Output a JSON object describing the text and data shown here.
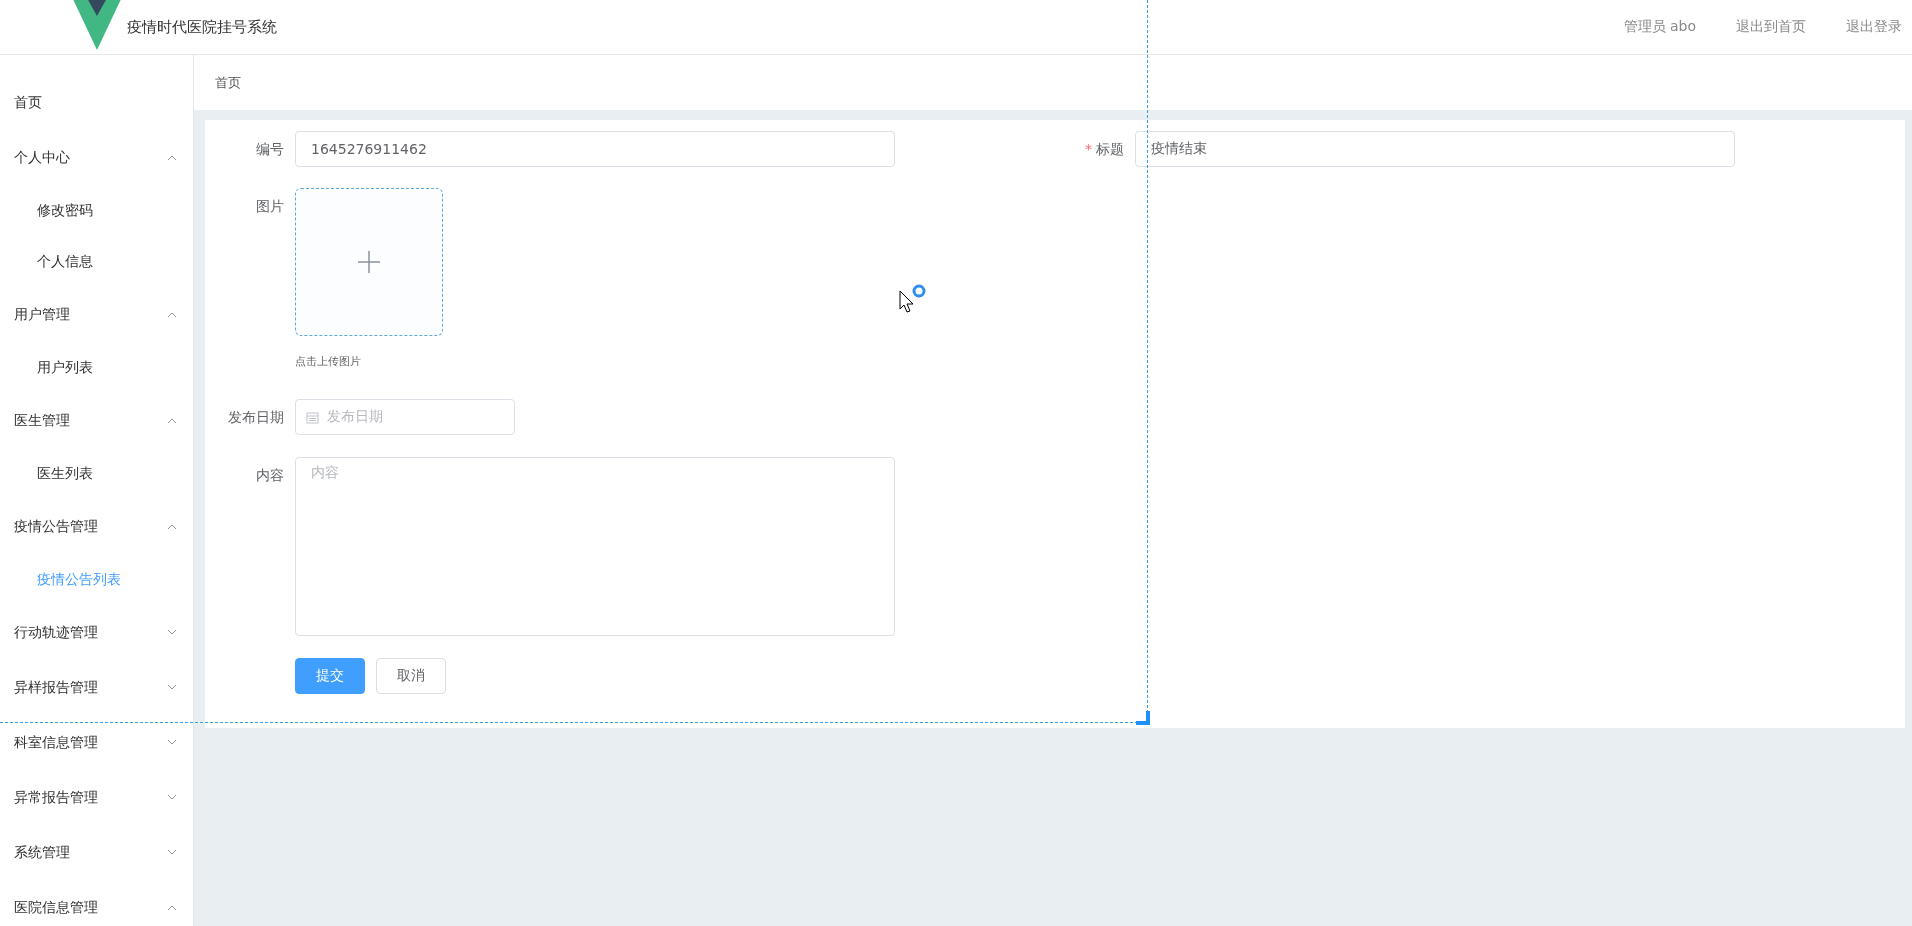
{
  "header": {
    "title": "疫情时代医院挂号系统",
    "links": [
      "管理员 abo",
      "退出到首页",
      "退出登录"
    ]
  },
  "sidebar": {
    "items": [
      {
        "label": "首页"
      },
      {
        "label": "个人中心",
        "expanded": true,
        "children": [
          {
            "label": "修改密码",
            "selected": false
          },
          {
            "label": "个人信息",
            "selected": false
          }
        ]
      },
      {
        "label": "用户管理",
        "expanded": true,
        "children": [
          {
            "label": "用户列表",
            "selected": false
          }
        ]
      },
      {
        "label": "医生管理",
        "expanded": true,
        "children": [
          {
            "label": "医生列表",
            "selected": false
          }
        ]
      },
      {
        "label": "疫情公告管理",
        "expanded": true,
        "children": [
          {
            "label": "疫情公告列表",
            "selected": true
          }
        ]
      },
      {
        "label": "行动轨迹管理",
        "expanded": false
      },
      {
        "label": "异样报告管理",
        "expanded": false
      },
      {
        "label": "科室信息管理",
        "expanded": false
      },
      {
        "label": "异常报告管理",
        "expanded": false
      },
      {
        "label": "系统管理",
        "expanded": false
      },
      {
        "label": "医院信息管理",
        "expanded": true
      }
    ]
  },
  "breadcrumb": "首页",
  "form": {
    "number": {
      "label": "编号",
      "value": "1645276911462"
    },
    "title": {
      "label": "标题",
      "required_mark": "*",
      "value": "疫情结束"
    },
    "image": {
      "label": "图片",
      "hint": "点击上传图片"
    },
    "date": {
      "label": "发布日期",
      "placeholder": "发布日期"
    },
    "content": {
      "label": "内容",
      "placeholder": "内容"
    },
    "buttons": [
      {
        "label": "提交",
        "kind": "primary"
      },
      {
        "label": "取消",
        "kind": "default"
      }
    ]
  }
}
